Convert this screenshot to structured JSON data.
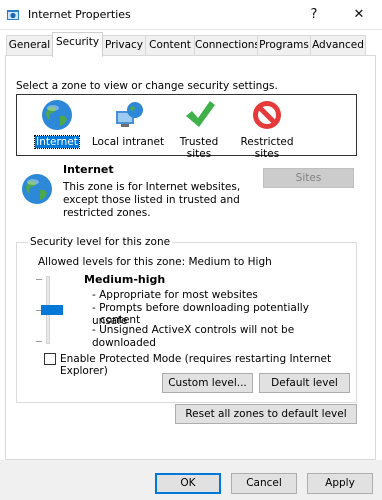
{
  "window": {
    "title": "Internet Properties",
    "help_glyph": "?",
    "close_glyph": "✕"
  },
  "tabs": [
    "General",
    "Security",
    "Privacy",
    "Content",
    "Connections",
    "Programs",
    "Advanced"
  ],
  "security": {
    "prompt": "Select a zone to view or change security settings.",
    "zones": [
      {
        "label": "Internet",
        "icon": "globe-icon",
        "selected": true
      },
      {
        "label": "Local intranet",
        "icon": "intranet-icon",
        "selected": false
      },
      {
        "label": "Trusted sites",
        "icon": "checkmark-icon",
        "selected": false
      },
      {
        "label": "Restricted sites",
        "label_line1": "Restricted",
        "label_line2": "sites",
        "icon": "restricted-icon",
        "selected": false
      }
    ],
    "zone_title": "Internet",
    "zone_description_lines": [
      "This zone is for Internet websites,",
      "except those listed in trusted and",
      "restricted zones."
    ],
    "sites_button": "Sites",
    "group_label": "Security level for this zone",
    "allowed_levels": "Allowed levels for this zone: Medium to High",
    "level_name": "Medium-high",
    "level_bullets": [
      "- Appropriate for most websites",
      "- Prompts before downloading potentially unsafe",
      "content",
      "- Unsigned ActiveX controls will not be downloaded"
    ],
    "protected_mode_label": "Enable Protected Mode (requires restarting Internet Explorer)",
    "protected_mode_checked": false,
    "custom_level_button": "Custom level...",
    "default_level_button": "Default level",
    "reset_all_button": "Reset all zones to default level"
  },
  "footer": {
    "ok": "OK",
    "cancel": "Cancel",
    "apply": "Apply"
  },
  "colors": {
    "accent": "#0078d7",
    "button_bg": "#e1e1e1",
    "button_border": "#adadad",
    "footer_bg": "#f0f0f0"
  }
}
